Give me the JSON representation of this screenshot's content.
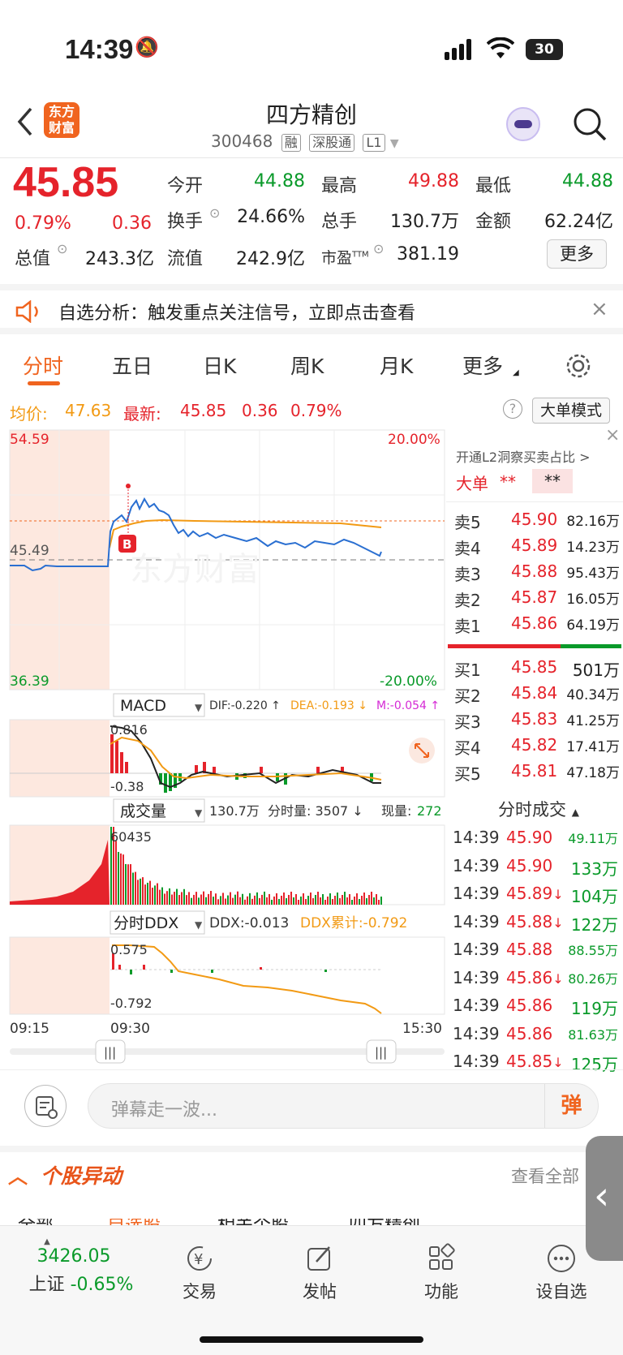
{
  "status": {
    "time": "14:39",
    "battery": "30"
  },
  "header": {
    "logo_line1": "东方",
    "logo_line2": "财富",
    "stock_name": "四方精创",
    "stock_code": "300468",
    "tags": [
      "融",
      "深股通",
      "L1"
    ]
  },
  "quote": {
    "price": "45.85",
    "change_pct": "0.79%",
    "change": "0.36",
    "open_label": "今开",
    "open": "44.88",
    "high_label": "最高",
    "high": "49.88",
    "low_label": "最低",
    "low": "44.88",
    "turnover_label": "换手",
    "turnover": "24.66%",
    "volume_label": "总手",
    "volume": "130.7万",
    "amount_label": "金额",
    "amount": "62.24亿",
    "mktcap_label": "总值",
    "mktcap": "243.3亿",
    "float_label": "流值",
    "float": "242.9亿",
    "pe_label": "市盈",
    "pe_sup": "TTM",
    "pe": "381.19",
    "more_label": "更多"
  },
  "banner": {
    "text": "自选分析：触发重点关注信号，立即点击查看"
  },
  "tabs": [
    "分时",
    "五日",
    "日K",
    "周K",
    "月K",
    "更多"
  ],
  "infobar": {
    "avg_label": "均价:",
    "avg": "47.63",
    "latest_label": "最新:",
    "latest": "45.85",
    "chg": "0.36",
    "chg_pct": "0.79%",
    "mode_label": "大单模式"
  },
  "main_chart": {
    "top_price": "54.59",
    "mid_price": "45.49",
    "bottom_price": "36.39",
    "top_pct": "20.00%",
    "bottom_pct": "-20.00%",
    "marker": "B",
    "watermark": "东方财富"
  },
  "macd": {
    "label": "MACD",
    "dif": "DIF:-0.220 ↑",
    "dea": "DEA:-0.193 ↓",
    "m": "M:-0.054 ↑",
    "top": "0.816",
    "bottom": "-0.38"
  },
  "volume": {
    "label": "成交量",
    "total": "130.7万",
    "fs": "分时量: 3507 ↓",
    "cur_label": "现量:",
    "cur": "272",
    "top": "60435"
  },
  "ddx": {
    "label": "分时DDX",
    "ddx": "DDX:-0.013",
    "cum": "DDX累计:-0.792",
    "top": "0.575",
    "bottom": "-0.792"
  },
  "time_axis": {
    "start": "09:15",
    "open": "09:30",
    "end": "15:30"
  },
  "orderbook": {
    "promo": "开通L2洞察买卖占比 >",
    "big_label": "大单",
    "big_val1": "**",
    "big_val2": "**",
    "asks": [
      {
        "label": "卖5",
        "price": "45.90",
        "vol": "82.16万"
      },
      {
        "label": "卖4",
        "price": "45.89",
        "vol": "14.23万"
      },
      {
        "label": "卖3",
        "price": "45.88",
        "vol": "95.43万"
      },
      {
        "label": "卖2",
        "price": "45.87",
        "vol": "16.05万"
      },
      {
        "label": "卖1",
        "price": "45.86",
        "vol": "64.19万"
      }
    ],
    "bids": [
      {
        "label": "买1",
        "price": "45.85",
        "vol": "501万"
      },
      {
        "label": "买2",
        "price": "45.84",
        "vol": "40.34万"
      },
      {
        "label": "买3",
        "price": "45.83",
        "vol": "41.25万"
      },
      {
        "label": "买4",
        "price": "45.82",
        "vol": "17.41万"
      },
      {
        "label": "买5",
        "price": "45.81",
        "vol": "47.18万"
      }
    ],
    "trades_title": "分时成交",
    "trades": [
      {
        "time": "14:39",
        "price": "45.90",
        "dir": "",
        "vol": "49.11万",
        "pc": "#e5232b",
        "vc": "#0a9a2a"
      },
      {
        "time": "14:39",
        "price": "45.90",
        "dir": "",
        "vol": "133万",
        "pc": "#e5232b",
        "vc": "#0a9a2a"
      },
      {
        "time": "14:39",
        "price": "45.89",
        "dir": "↓",
        "vol": "104万",
        "pc": "#e5232b",
        "vc": "#0a9a2a"
      },
      {
        "time": "14:39",
        "price": "45.88",
        "dir": "↓",
        "vol": "122万",
        "pc": "#e5232b",
        "vc": "#0a9a2a"
      },
      {
        "time": "14:39",
        "price": "45.88",
        "dir": "",
        "vol": "88.55万",
        "pc": "#e5232b",
        "vc": "#0a9a2a"
      },
      {
        "time": "14:39",
        "price": "45.86",
        "dir": "↓",
        "vol": "80.26万",
        "pc": "#e5232b",
        "vc": "#0a9a2a"
      },
      {
        "time": "14:39",
        "price": "45.86",
        "dir": "",
        "vol": "119万",
        "pc": "#e5232b",
        "vc": "#0a9a2a"
      },
      {
        "time": "14:39",
        "price": "45.86",
        "dir": "",
        "vol": "81.63万",
        "pc": "#e5232b",
        "vc": "#0a9a2a"
      },
      {
        "time": "14:39",
        "price": "45.85",
        "dir": "↓",
        "vol": "125万",
        "pc": "#e5232b",
        "vc": "#0a9a2a"
      }
    ]
  },
  "input": {
    "placeholder": "弹幕走一波...",
    "send_label": "弹"
  },
  "movers": {
    "title": "个股异动",
    "view_all": "查看全部",
    "subtabs": [
      "全部",
      "自选股",
      "相关个股",
      "四方精创"
    ]
  },
  "bottom_nav": {
    "index_value": "3426.05",
    "index_name": "上证",
    "index_chg": "-0.65%",
    "items": [
      {
        "label": "交易",
        "icon": "trade-icon"
      },
      {
        "label": "发帖",
        "icon": "edit-icon"
      },
      {
        "label": "功能",
        "icon": "grid-icon"
      },
      {
        "label": "设自选",
        "icon": "more-icon"
      }
    ]
  },
  "colors": {
    "up": "#e5232b",
    "down": "#0a9a2a",
    "accent": "#f0641f",
    "avg_line": "#f29a14",
    "price_line": "#2a6fd1"
  }
}
